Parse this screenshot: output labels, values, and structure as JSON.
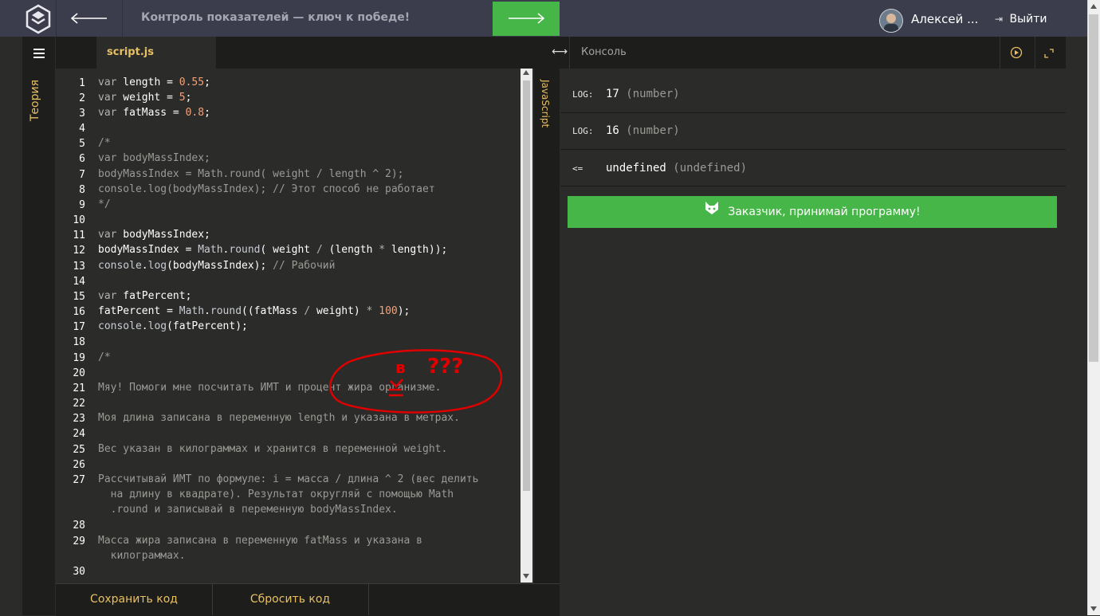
{
  "header": {
    "title": "Контроль показателей — ключ к победе!",
    "user_name": "Алексей ...",
    "logout_label": "Выйти"
  },
  "sidebar": {
    "theory_label": "Теория"
  },
  "editor": {
    "tab_label": "script.js",
    "language_label": "JavaScript",
    "line_numbers": [
      "1",
      "2",
      "3",
      "4",
      "5",
      "6",
      "7",
      "8",
      "9",
      "10",
      "11",
      "12",
      "13",
      "14",
      "15",
      "16",
      "17",
      "18",
      "19",
      "20",
      "21",
      "22",
      "23",
      "24",
      "25",
      "26",
      "27",
      "28",
      "29",
      "30"
    ],
    "lines": {
      "l1_var": "var",
      "l1_a": " length = ",
      "l1_num": "0.55",
      "l1_b": ";",
      "l2_var": "var",
      "l2_a": " weight = ",
      "l2_num": "5",
      "l2_b": ";",
      "l3_var": "var",
      "l3_a": " fatMass = ",
      "l3_num": "0.8",
      "l3_b": ";",
      "l5": "/*",
      "l6": "var bodyMassIndex;",
      "l7": "bodyMassIndex = Math.round( weight / length ^ 2);",
      "l8": "console.log(bodyMassIndex); // Этот способ не работает",
      "l9": "*/",
      "l11_var": "var",
      "l11_a": " bodyMassIndex;",
      "l12_a": "bodyMassIndex = ",
      "l12_math": "Math",
      "l12_b": ".",
      "l12_round": "round",
      "l12_c": "( weight ",
      "l12_op": "/",
      "l12_d": " (length ",
      "l12_op2": "*",
      "l12_e": " length));",
      "l13_a": "console",
      "l13_b": ".",
      "l13_log": "log",
      "l13_c": "(bodyMassIndex); ",
      "l13_comment": "// Рабочий",
      "l15_var": "var",
      "l15_a": " fatPercent;",
      "l16_a": "fatPercent = ",
      "l16_math": "Math",
      "l16_b": ".",
      "l16_round": "round",
      "l16_c": "((fatMass ",
      "l16_op": "/",
      "l16_d": " weight) ",
      "l16_op2": "*",
      "l16_e": " ",
      "l16_num": "100",
      "l16_f": ");",
      "l17_a": "console",
      "l17_b": ".",
      "l17_log": "log",
      "l17_c": "(fatPercent);",
      "l19": "/*",
      "l21": "Мяу! Помоги мне посчитать ИМТ и процент жира организме.",
      "l23": "Моя длина записана в переменную length и указана в метрах.",
      "l25": "Вес указан в килограммах и хранится в переменной weight.",
      "l27a": "Рассчитывай ИМТ по формуле: i = масса / длина ^ 2 (вес делить",
      "l27b": "  на длину в квадрате). Результат округляй с помощью Math",
      "l27c": "  .round и записывай в переменную bodyMassIndex.",
      "l29a": "Масса жира записана в переменную fatMass и указана в",
      "l29b": "  килограммах."
    },
    "annotation": {
      "letter": "в",
      "question": "???"
    },
    "save_label": "Сохранить код",
    "reset_label": "Сбросить код"
  },
  "console": {
    "title": "Консоль",
    "entries": [
      {
        "tag": "LOG:",
        "value": "17",
        "type": "(number)"
      },
      {
        "tag": "LOG:",
        "value": "16",
        "type": "(number)"
      },
      {
        "tag": "<=",
        "value": "undefined",
        "type": "(undefined)"
      }
    ],
    "submit_label": "Заказчик, принимай программу!"
  },
  "colors": {
    "accent_green": "#47b648",
    "accent_yellow": "#e8c064",
    "topbar": "#3b3d4c"
  }
}
